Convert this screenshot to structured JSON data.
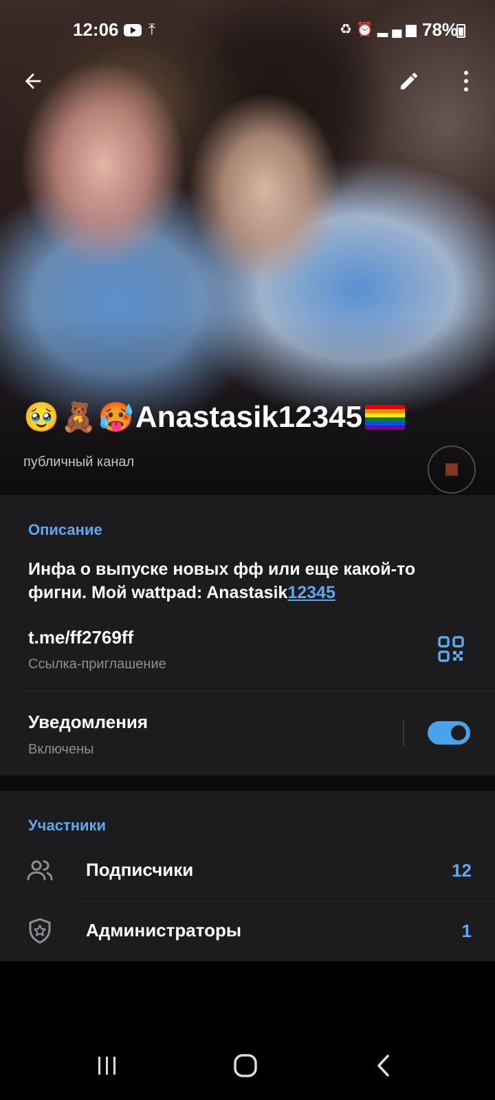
{
  "status_bar": {
    "time": "12:06",
    "battery": "78%",
    "icons": [
      "youtube-icon",
      "upload-icon",
      "recycle-icon",
      "alarm-icon",
      "network-h-plus-icon",
      "signal-icon",
      "battery-icon"
    ]
  },
  "toolbar": {
    "back_icon": "arrow-left-icon",
    "edit_icon": "pencil-icon",
    "more_icon": "three-dots-vertical-icon"
  },
  "channel": {
    "emojis": [
      "🥹",
      "🧸",
      "🥵"
    ],
    "name": "Anastasik12345",
    "flag": "🏳️‍🌈",
    "subtitle": "публичный канал"
  },
  "description": {
    "label": "Описание",
    "text_plain": "Инфа о выпуске новых фф или еще какой-то фигни. Мой wattpad: Anastasik",
    "text_link": "12345"
  },
  "invite_link": {
    "url": "t.me/ff2769ff",
    "caption": "Ссылка-приглашение",
    "icon": "qr-code-icon"
  },
  "notifications": {
    "title": "Уведомления",
    "status": "Включены",
    "enabled": true
  },
  "members": {
    "label": "Участники",
    "rows": [
      {
        "label": "Подписчики",
        "count": "12",
        "icon": "people-icon"
      },
      {
        "label": "Администраторы",
        "count": "1",
        "icon": "shield-star-icon"
      }
    ]
  },
  "colors": {
    "accent": "#5ea8ef",
    "card_bg": "#1c1c1e",
    "secondary_text": "#8e8e93"
  },
  "nav": {
    "recent_icon": "recent-apps-icon",
    "home_icon": "home-icon",
    "back_icon": "nav-back-icon"
  }
}
